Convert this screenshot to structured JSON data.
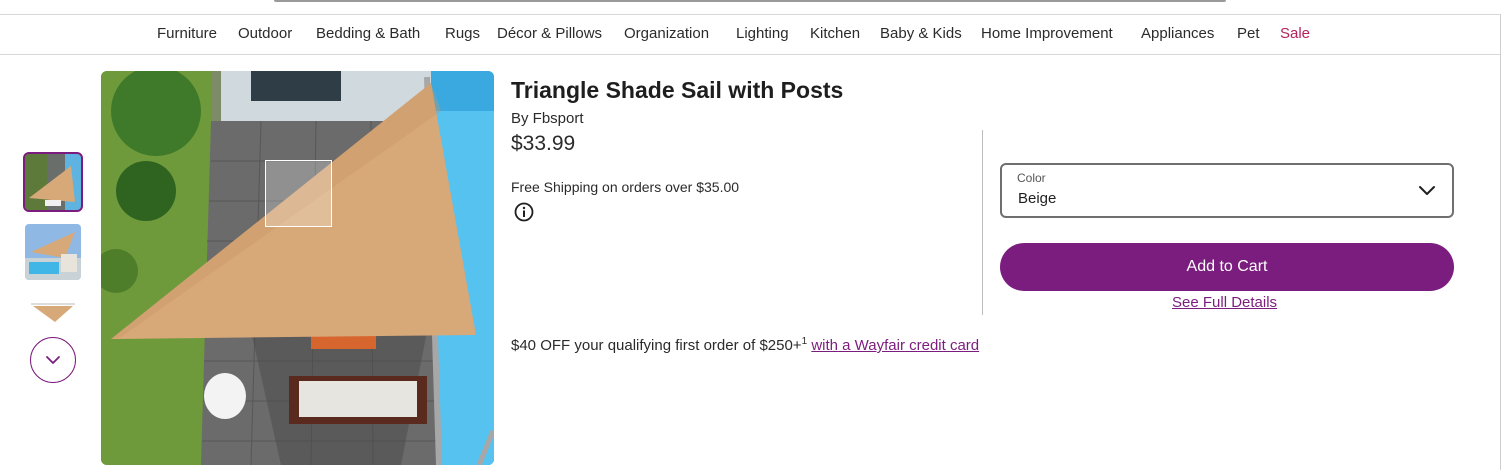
{
  "nav": {
    "items": [
      "Furniture",
      "Outdoor",
      "Bedding & Bath",
      "Rugs",
      "Décor & Pillows",
      "Organization",
      "Lighting",
      "Kitchen",
      "Baby & Kids",
      "Home Improvement",
      "Appliances",
      "Pet",
      "Sale"
    ]
  },
  "gallery": {
    "selected_index": 0,
    "thumbnails_count": 3,
    "scroll_icon": "chevron-down-icon"
  },
  "product": {
    "title": "Triangle Shade Sail with Posts",
    "brand": "By Fbsport",
    "price": "$33.99",
    "shipping": "Free Shipping on orders over $35.00",
    "info_icon": "info-icon"
  },
  "options": {
    "color_label": "Color",
    "color_value": "Beige"
  },
  "actions": {
    "add_to_cart": "Add to Cart",
    "see_details": "See Full Details"
  },
  "promo": {
    "text": "$40 OFF your qualifying first order of $250+",
    "sup": "1",
    "link": "with a Wayfair credit card"
  },
  "colors": {
    "accent": "#7b1d7e",
    "sale": "#b5225b",
    "sail": "#d7a878"
  }
}
